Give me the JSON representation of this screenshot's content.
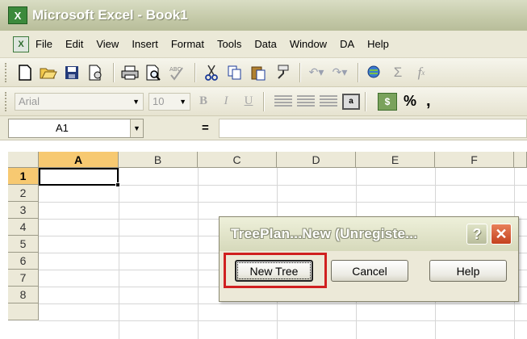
{
  "window": {
    "title": "Microsoft Excel - Book1",
    "icon_label": "X"
  },
  "menu": {
    "doc_icon_label": "X",
    "items": [
      "File",
      "Edit",
      "View",
      "Insert",
      "Format",
      "Tools",
      "Data",
      "Window",
      "DA",
      "Help"
    ]
  },
  "standard_toolbar": {
    "icons": [
      "new-icon",
      "open-icon",
      "save-icon",
      "permission-icon",
      "print-icon",
      "print-preview-icon",
      "spelling-icon",
      "cut-icon",
      "copy-icon",
      "paste-icon",
      "format-painter-icon",
      "undo-icon",
      "redo-icon",
      "hyperlink-icon",
      "autosum-icon",
      "function-icon"
    ]
  },
  "formatting_toolbar": {
    "font": "Arial",
    "font_size": "10",
    "bold": "B",
    "italic": "I",
    "underline": "U",
    "currency_label": "$",
    "percent_label": "%",
    "comma_label": ","
  },
  "formula_bar": {
    "name_box": "A1",
    "equals": "=",
    "formula": ""
  },
  "grid": {
    "columns": [
      "A",
      "B",
      "C",
      "D",
      "E",
      "F"
    ],
    "rows": [
      "1",
      "2",
      "3",
      "4",
      "5",
      "6",
      "7",
      "8"
    ],
    "active_cell": "A1"
  },
  "dialog": {
    "title": "TreePlan...New (Unregiste...",
    "help_icon_label": "?",
    "close_icon_label": "✕",
    "buttons": {
      "new_tree": "New Tree",
      "cancel": "Cancel",
      "help": "Help"
    },
    "highlight_color": "#d02020"
  },
  "colors": {
    "title_bar": "#c4c9a8",
    "active_header": "#f7c971",
    "chrome": "#ece9d8"
  }
}
